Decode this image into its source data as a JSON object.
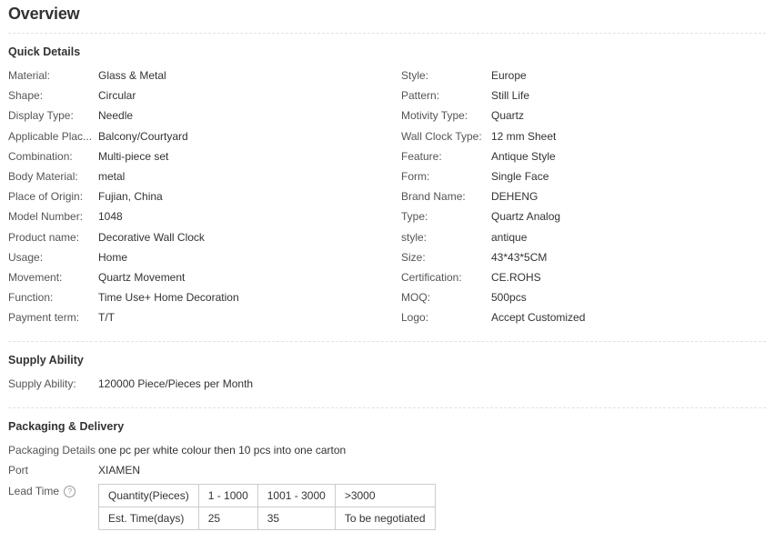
{
  "overview": {
    "title": "Overview"
  },
  "quick_details": {
    "title": "Quick Details",
    "left": [
      {
        "label": "Material:",
        "value": "Glass & Metal"
      },
      {
        "label": "Shape:",
        "value": "Circular"
      },
      {
        "label": "Display Type:",
        "value": "Needle"
      },
      {
        "label": "Applicable Plac...",
        "value": "Balcony/Courtyard"
      },
      {
        "label": "Combination:",
        "value": "Multi-piece set"
      },
      {
        "label": "Body Material:",
        "value": "metal"
      },
      {
        "label": "Place of Origin:",
        "value": "Fujian, China"
      },
      {
        "label": "Model Number:",
        "value": "1048"
      },
      {
        "label": "Product name:",
        "value": "Decorative Wall Clock"
      },
      {
        "label": "Usage:",
        "value": "Home"
      },
      {
        "label": "Movement:",
        "value": "Quartz Movement"
      },
      {
        "label": "Function:",
        "value": "Time Use+ Home Decoration"
      },
      {
        "label": "Payment term:",
        "value": "T/T"
      }
    ],
    "right": [
      {
        "label": "Style:",
        "value": "Europe"
      },
      {
        "label": "Pattern:",
        "value": "Still Life"
      },
      {
        "label": "Motivity Type:",
        "value": "Quartz"
      },
      {
        "label": "Wall Clock Type:",
        "value": "12 mm Sheet"
      },
      {
        "label": "Feature:",
        "value": "Antique Style"
      },
      {
        "label": "Form:",
        "value": "Single Face"
      },
      {
        "label": "Brand Name:",
        "value": "DEHENG"
      },
      {
        "label": "Type:",
        "value": "Quartz Analog"
      },
      {
        "label": "style:",
        "value": "antique"
      },
      {
        "label": "Size:",
        "value": "43*43*5CM"
      },
      {
        "label": "Certification:",
        "value": "CE.ROHS"
      },
      {
        "label": "MOQ:",
        "value": "500pcs"
      },
      {
        "label": "Logo:",
        "value": "Accept Customized"
      }
    ]
  },
  "supply": {
    "title": "Supply Ability",
    "label": "Supply Ability:",
    "value": "120000 Piece/Pieces per Month"
  },
  "packaging": {
    "title": "Packaging & Delivery",
    "details_label": "Packaging Details",
    "details_value": "one pc per white colour then 10 pcs into one carton",
    "port_label": "Port",
    "port_value": "XIAMEN",
    "lead_label": "Lead Time",
    "lead_icon": "question-mark-icon",
    "lead_table": [
      [
        "Quantity(Pieces)",
        "1 - 1000",
        "1001 - 3000",
        ">3000"
      ],
      [
        "Est. Time(days)",
        "25",
        "35",
        "To be negotiated"
      ]
    ]
  }
}
